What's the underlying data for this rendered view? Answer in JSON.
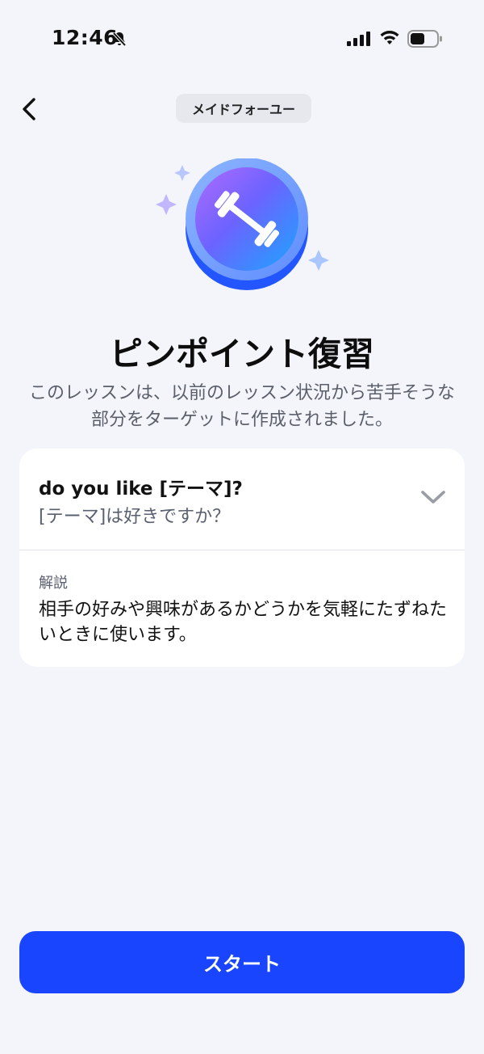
{
  "status_bar": {
    "time": "12:46"
  },
  "header": {
    "back_icon": "chevron-left-icon",
    "badge": "メイドフォーユー"
  },
  "hero": {
    "icon": "dumbbell-icon",
    "sparkle_icon": "sparkle-icon"
  },
  "lesson": {
    "title": "ピンポイント復習",
    "description": "このレッスンは、以前のレッスン状況から苦手そうな部分をターゲットに作成されました。"
  },
  "card": {
    "phrase": "do you like [テーマ]?",
    "translation": "[テーマ]は好きですか？",
    "expand_icon": "chevron-down-icon",
    "explanation_label": "解説",
    "explanation_text": "相手の好みや興味があるかどうかを気軽にたずねたいときに使います。"
  },
  "footer": {
    "start_label": "スタート"
  },
  "colors": {
    "accent": "#1a45ff",
    "background": "#f3f5fa",
    "card": "#ffffff"
  }
}
